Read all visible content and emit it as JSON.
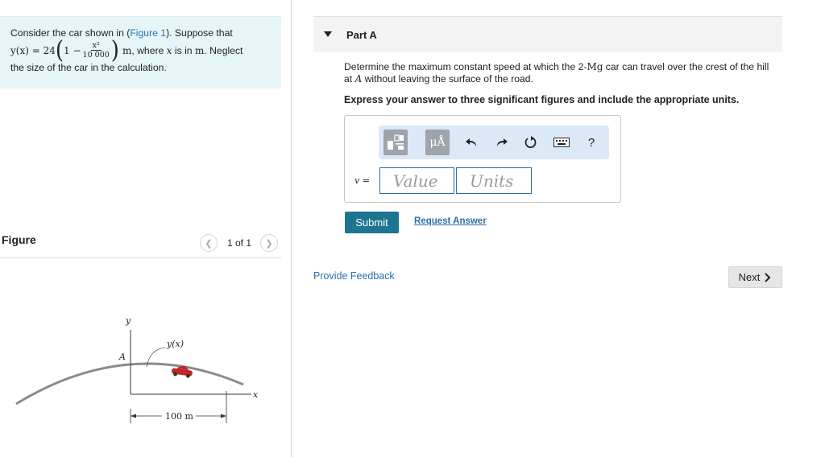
{
  "problem": {
    "text_start": "Consider the car shown in (",
    "figure_link": "Figure 1",
    "text_after_link": "). Suppose that",
    "eq_lhs": "y(x) = 24",
    "eq_one_minus": "1 −",
    "eq_num": "x²",
    "eq_den": "10 000",
    "eq_unit": "m",
    "eq_where": ", where",
    "eq_var": "x",
    "eq_is_in": "is in",
    "eq_unit2": "m",
    "eq_neglect": ". Neglect",
    "text_end": "the size of the car in the calculation."
  },
  "figure": {
    "title": "Figure",
    "page_count": "1 of 1",
    "prev_icon": "chevron-left-icon",
    "next_icon": "chevron-right-icon",
    "axis_y": "y",
    "axis_x": "x",
    "point_a": "A",
    "curve_label": "y(x)",
    "dimension": "100 m"
  },
  "part": {
    "title": "Part A",
    "question_pre": "Determine the maximum constant speed at which the 2-",
    "question_unit": "Mg",
    "question_mid": " car can travel over the crest of the hill at ",
    "question_point": "A",
    "question_post": " without leaving the surface of the road.",
    "instruction": "Express your answer to three significant figures and include the appropriate units."
  },
  "answer": {
    "toolbar": {
      "template_icon": "template-icon",
      "units_label": "μÅ",
      "undo_icon": "undo-icon",
      "redo_icon": "redo-icon",
      "reset_icon": "reset-icon",
      "keyboard_icon": "keyboard-icon",
      "help_label": "?"
    },
    "variable": "v",
    "equals": "=",
    "value_placeholder": "Value",
    "units_placeholder": "Units"
  },
  "actions": {
    "submit": "Submit",
    "request": "Request Answer",
    "feedback": "Provide Feedback",
    "next": "Next",
    "next_icon": "chevron-right-icon"
  },
  "colors": {
    "problem_bg": "#e6f6f8",
    "link": "#2a6fab",
    "submit_bg": "#1d7591",
    "toolbar_bg": "#dbe9f7",
    "car": "#c0262a"
  }
}
